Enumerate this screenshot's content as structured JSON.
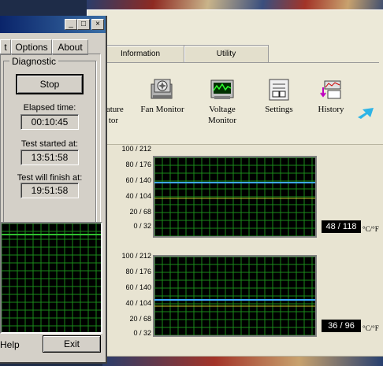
{
  "dialog": {
    "menu": {
      "left_cut": "t",
      "options": "Options",
      "about": "About"
    },
    "group_title": "Diagnostic",
    "stop_label": "Stop",
    "elapsed_label": "Elapsed time:",
    "elapsed_value": "00:10:45",
    "started_label": "Test started at:",
    "started_value": "13:51:58",
    "finish_label": "Test will finish at:",
    "finish_value": "19:51:58",
    "help_label": "Help",
    "exit_label": "Exit",
    "title_buttons": {
      "minimize": "_",
      "maximize": "□",
      "close": "×"
    }
  },
  "monitor": {
    "tabs": [
      "Information",
      "Utility"
    ],
    "tools": [
      {
        "label": "rature\ntor",
        "icon": "temperature-icon"
      },
      {
        "label": "Fan Monitor",
        "icon": "fan-icon"
      },
      {
        "label": "Voltage\nMonitor",
        "icon": "voltage-icon"
      },
      {
        "label": "Settings",
        "icon": "settings-icon"
      },
      {
        "label": "History",
        "icon": "history-icon"
      },
      {
        "label": "",
        "icon": "arrow-icon"
      }
    ],
    "y_labels": [
      "100 / 212",
      "80 / 176",
      "60 / 140",
      "40 / 104",
      "20 /  68",
      "0 /  32"
    ],
    "graphs": [
      {
        "readout": "48 / 118",
        "unit": "°C/°F",
        "line_color": "#3ea8ff"
      },
      {
        "readout": "36 / 96",
        "unit": "°C/°F",
        "line_color": "#3ea8ff"
      }
    ]
  }
}
